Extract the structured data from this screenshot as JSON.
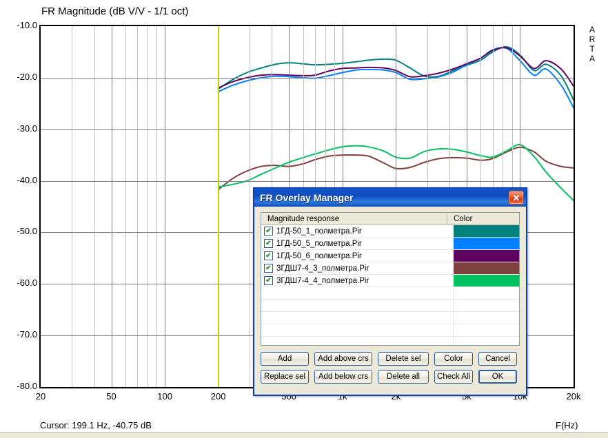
{
  "chart_data": {
    "type": "line",
    "title": "FR Magnitude (dB V/V - 1/1 oct)",
    "xlabel": "F(Hz)",
    "ylabel": "",
    "xscale": "log",
    "xlim": [
      20,
      20000
    ],
    "ylim": [
      -80,
      -10
    ],
    "grid": true,
    "legend_position": "none",
    "xticks": [
      "20",
      "50",
      "100",
      "200",
      "500",
      "1k",
      "2k",
      "5k",
      "10k",
      "20k"
    ],
    "xtick_values": [
      20,
      50,
      100,
      200,
      500,
      1000,
      2000,
      5000,
      10000,
      20000
    ],
    "yticks": [
      "-10.0",
      "-20.0",
      "-30.0",
      "-40.0",
      "-50.0",
      "-60.0",
      "-70.0",
      "-80.0"
    ],
    "ytick_values": [
      -10,
      -20,
      -30,
      -40,
      -50,
      -60,
      -70,
      -80
    ],
    "cursor_frequency_hz": 199.1,
    "cursor_level_db": -40.75,
    "series": [
      {
        "name": "1ГД-50_1_полметра.Pir",
        "color": "#00807f",
        "x": [
          200,
          240,
          290,
          350,
          420,
          500,
          600,
          700,
          840,
          1000,
          1200,
          1400,
          1700,
          2000,
          2400,
          2900,
          3500,
          4200,
          5000,
          6000,
          7000,
          8400,
          10000,
          12000,
          14000,
          17000,
          20000
        ],
        "y": [
          -22.2,
          -20.4,
          -19.0,
          -18.1,
          -17.4,
          -17.1,
          -17.3,
          -17.5,
          -17.4,
          -17.2,
          -16.9,
          -16.6,
          -16.4,
          -16.6,
          -18.1,
          -19.7,
          -19.7,
          -18.6,
          -17.6,
          -16.6,
          -15.0,
          -14.0,
          -15.6,
          -18.6,
          -17.4,
          -19.6,
          -24.3
        ]
      },
      {
        "name": "1ГД-50_5_полметра.Pir",
        "color": "#0080ff",
        "x": [
          200,
          240,
          290,
          350,
          420,
          500,
          600,
          700,
          840,
          1000,
          1200,
          1400,
          1700,
          2000,
          2400,
          2900,
          3500,
          4200,
          5000,
          6000,
          7000,
          8400,
          10000,
          12000,
          14000,
          17000,
          20000
        ],
        "y": [
          -22.7,
          -21.5,
          -20.6,
          -20.0,
          -19.7,
          -19.8,
          -20.0,
          -20.1,
          -19.6,
          -19.0,
          -18.5,
          -18.4,
          -18.5,
          -19.0,
          -20.3,
          -20.2,
          -19.8,
          -18.9,
          -17.5,
          -16.2,
          -14.6,
          -14.3,
          -16.7,
          -19.5,
          -18.3,
          -21.4,
          -25.8
        ]
      },
      {
        "name": "1ГД-50_6_полметра.Pir",
        "color": "#600060",
        "x": [
          200,
          240,
          290,
          350,
          420,
          500,
          600,
          700,
          840,
          1000,
          1200,
          1400,
          1700,
          2000,
          2400,
          2900,
          3500,
          4200,
          5000,
          6000,
          7000,
          8400,
          10000,
          12000,
          14000,
          17000,
          20000
        ],
        "y": [
          -22.0,
          -20.8,
          -20.0,
          -19.5,
          -19.4,
          -19.5,
          -19.6,
          -19.5,
          -18.7,
          -18.2,
          -18.1,
          -18.0,
          -18.1,
          -18.6,
          -19.8,
          -19.6,
          -19.1,
          -18.3,
          -17.3,
          -16.2,
          -14.7,
          -14.2,
          -15.8,
          -18.2,
          -16.7,
          -18.3,
          -21.6
        ]
      },
      {
        "name": "3ГДШ7-4_3_полметра.Pir",
        "color": "#804040",
        "x": [
          200,
          240,
          290,
          350,
          420,
          500,
          600,
          700,
          840,
          1000,
          1200,
          1400,
          1700,
          2000,
          2400,
          2900,
          3500,
          4200,
          5000,
          6000,
          7000,
          8400,
          10000,
          12000,
          14000,
          17000,
          20000
        ],
        "y": [
          -41.7,
          -39.6,
          -38.1,
          -37.2,
          -37.0,
          -37.2,
          -36.7,
          -35.9,
          -35.2,
          -35.0,
          -35.0,
          -35.2,
          -36.5,
          -37.6,
          -37.4,
          -36.4,
          -35.7,
          -35.5,
          -35.6,
          -36.0,
          -35.7,
          -34.4,
          -33.5,
          -34.4,
          -36.2,
          -37.2,
          -37.5
        ]
      },
      {
        "name": "3ГДШ7-4_4_полметра.Pir",
        "color": "#00c060",
        "x": [
          200,
          240,
          290,
          350,
          420,
          500,
          600,
          700,
          840,
          1000,
          1200,
          1400,
          1700,
          2000,
          2400,
          2900,
          3500,
          4200,
          5000,
          6000,
          7000,
          8400,
          10000,
          12000,
          14000,
          17000,
          20000
        ],
        "y": [
          -41.2,
          -40.7,
          -40.0,
          -38.7,
          -37.5,
          -36.4,
          -35.5,
          -34.8,
          -34.0,
          -33.4,
          -33.2,
          -33.4,
          -34.2,
          -35.4,
          -35.6,
          -34.3,
          -33.8,
          -33.9,
          -34.4,
          -35.1,
          -35.4,
          -34.2,
          -33.0,
          -35.3,
          -38.3,
          -41.4,
          -43.8
        ]
      }
    ]
  },
  "chart": {
    "title": "FR Magnitude (dB V/V - 1/1 oct)",
    "watermark": "ARTA",
    "cursor_readout": "Cursor: 199.1 Hz, -40.75 dB",
    "xaxis_caption": "F(Hz)"
  },
  "dialog": {
    "title": "FR Overlay Manager",
    "close_glyph": "✕",
    "list": {
      "headers": [
        "Magnitude response",
        "Color"
      ],
      "rows": [
        {
          "checked": true,
          "label": "1ГД-50_1_полметра.Pir",
          "color": "#00807f"
        },
        {
          "checked": true,
          "label": "1ГД-50_5_полметра.Pir",
          "color": "#0080ff"
        },
        {
          "checked": true,
          "label": "1ГД-50_6_полметра.Pir",
          "color": "#600060"
        },
        {
          "checked": true,
          "label": "3ГДШ7-4_3_полметра.Pir",
          "color": "#804040"
        },
        {
          "checked": true,
          "label": "3ГДШ7-4_4_полметра.Pir",
          "color": "#00c060"
        }
      ],
      "empty_row_count": 5,
      "check_glyph": "✔"
    },
    "buttons": {
      "add": "Add",
      "add_above_crs": "Add above crs",
      "delete_sel": "Delete sel",
      "color": "Color",
      "cancel": "Cancel",
      "replace_sel": "Replace sel",
      "add_below_crs": "Add below crs",
      "delete_all": "Delete all",
      "check_all": "Check All",
      "ok": "OK"
    }
  }
}
